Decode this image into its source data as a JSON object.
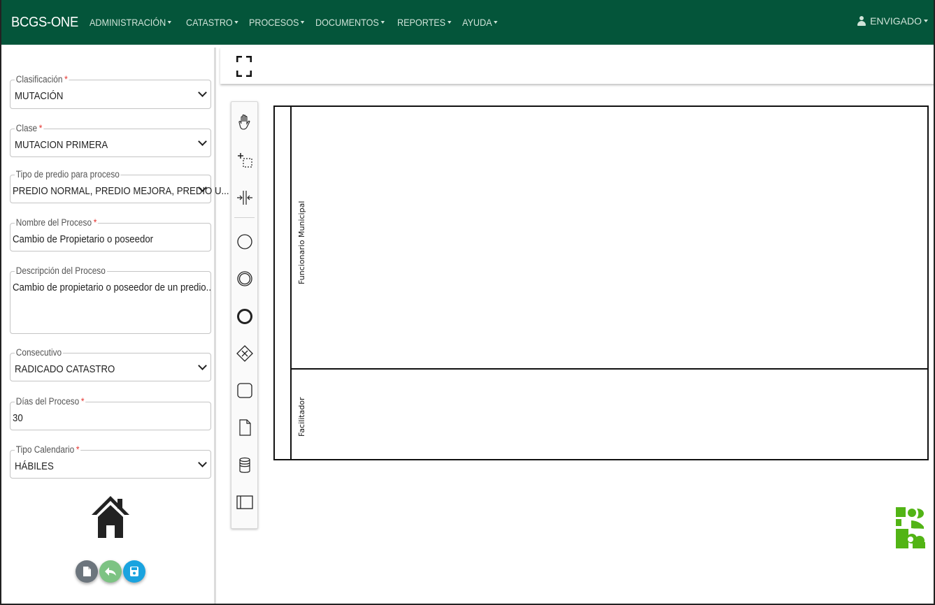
{
  "navbar": {
    "brand": "BCGS-ONE",
    "menu": [
      "ADMINISTRACIÓN",
      "CATASTRO",
      "PROCESOS",
      "DOCUMENTOS",
      "REPORTES",
      "AYUDA"
    ],
    "user": "ENVIGADO",
    "bg_color": "#04553a"
  },
  "form": {
    "clasificacion": {
      "label": "Clasificación",
      "value": "MUTACIÓN"
    },
    "clase": {
      "label": "Clase",
      "value": "MUTACION PRIMERA"
    },
    "tipo_predio": {
      "label": "Tipo de predio para proceso",
      "value": "PREDIO NORMAL, PREDIO MEJORA, PREDIO U..."
    },
    "nombre": {
      "label": "Nombre del Proceso",
      "value": "Cambio de Propietario o poseedor"
    },
    "descripcion": {
      "label": "Descripción del Proceso",
      "value": "Cambio de propietario o poseedor de un predio.."
    },
    "consecutivo": {
      "label": "Consecutivo",
      "value": "RADICADO CATASTRO"
    },
    "dias": {
      "label": "Días del Proceso",
      "value": "30"
    },
    "tipo_calendario": {
      "label": "Tipo Calendario",
      "value": "HÁBILES"
    },
    "required_marker": "*"
  },
  "actions": {
    "icons": [
      "home-icon",
      "new-document-icon",
      "back-reply-icon",
      "save-icon"
    ],
    "colors": {
      "new": "#6c757d",
      "back": "#7dc383",
      "save": "#1aa3df"
    }
  },
  "palette": {
    "tools": [
      "hand-tool-icon",
      "lasso-tool-icon",
      "space-tool-icon",
      "start-event-icon",
      "intermediate-event-icon",
      "end-event-icon",
      "gateway-icon",
      "task-icon",
      "data-object-icon",
      "data-store-icon",
      "pool-icon"
    ]
  },
  "diagram": {
    "lanes": [
      "Funcionario Municipal",
      "Facilitador"
    ]
  }
}
